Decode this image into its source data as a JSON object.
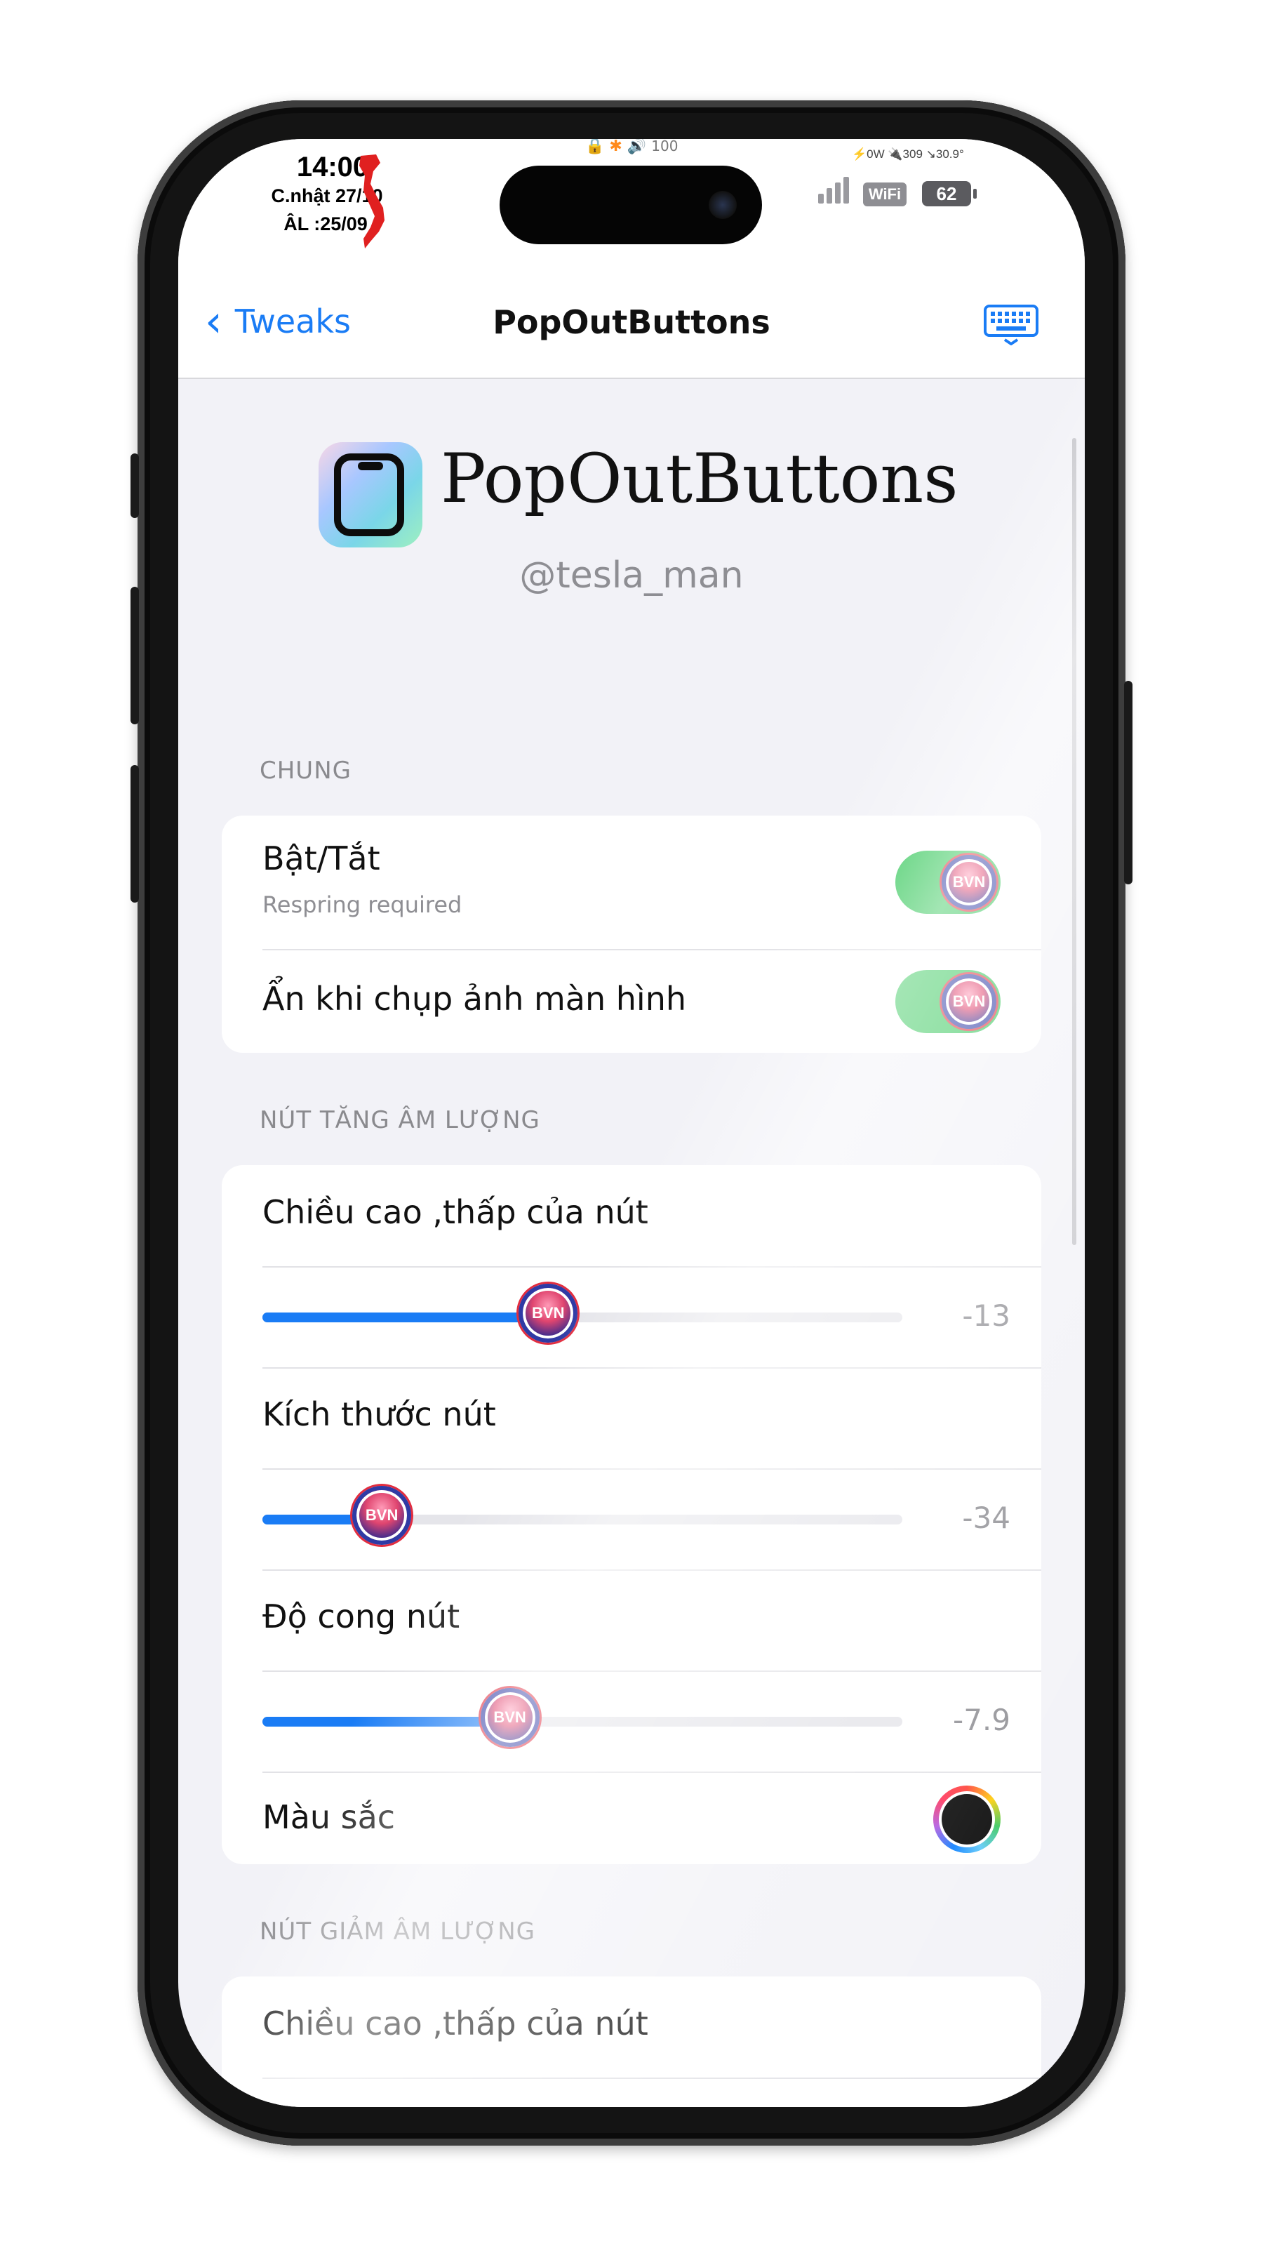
{
  "status_bar": {
    "time": "14:00",
    "date": "C.nhật 27/10",
    "lunar_date": "ÂL :25/09",
    "top_indicator": "100",
    "stats_line": "⚡0W  🔌309  ↘30.9°",
    "wifi_label": "WiFi",
    "battery": "62"
  },
  "nav": {
    "back_label": "Tweaks",
    "title": "PopOutButtons",
    "keyboard_icon": "keyboard-icon"
  },
  "header": {
    "app_name": "PopOutButtons",
    "author": "@tesla_man"
  },
  "sections": {
    "general": {
      "title": "CHUNG",
      "rows": [
        {
          "label": "Bật/Tắt",
          "subtitle": "Respring required",
          "toggle": true,
          "badge": "BVN"
        },
        {
          "label": "Ẩn khi chụp ảnh màn hình",
          "toggle": true,
          "badge": "BVN"
        }
      ]
    },
    "volume_up": {
      "title": "NÚT TĂNG ÂM LƯỢNG",
      "height_label": "Chiều cao ,thấp của nút",
      "height_value": "-13",
      "height_fraction": 0.44,
      "size_label": "Kích thước nút",
      "size_value": "-34",
      "size_fraction": 0.18,
      "corner_label": "Độ cong nút",
      "corner_value": "-7.9",
      "corner_fraction": 0.38,
      "color_label": "Màu sắc",
      "color_value": "#000000",
      "thumb_badge": "BVN"
    },
    "volume_down": {
      "title": "NÚT GIẢM ÂM LƯỢNG",
      "height_label": "Chiều cao ,thấp của nút"
    }
  },
  "colors": {
    "accent": "#1a7cf5",
    "toggle_on": "#34c759",
    "background": "#f2f2f7"
  }
}
